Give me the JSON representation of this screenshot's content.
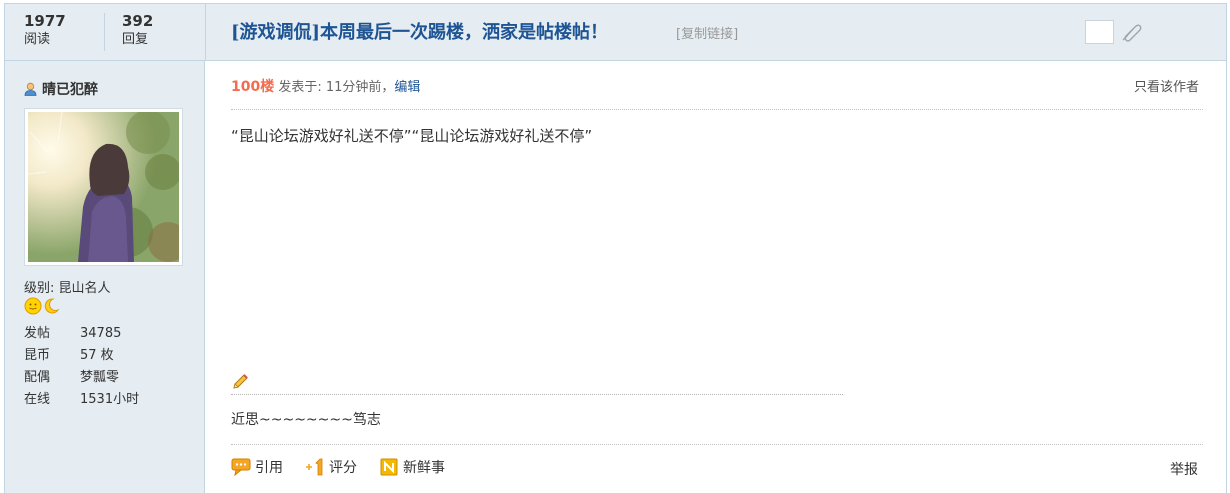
{
  "stats": {
    "views_value": "1977",
    "views_label": "阅读",
    "replies_value": "392",
    "replies_label": "回复"
  },
  "thread": {
    "title": "[游戏调侃]本周最后一次踢楼，洒家是帖楼帖！",
    "copy_link": "[复制链接]"
  },
  "author": {
    "name": "晴已犯醉",
    "level": "级别: 昆山名人",
    "info": [
      {
        "key": "发帖",
        "value": "34785"
      },
      {
        "key": "昆币",
        "value": "57 枚"
      },
      {
        "key": "配偶",
        "value": "梦瓢零"
      },
      {
        "key": "在线",
        "value": "1531小时"
      }
    ]
  },
  "post": {
    "floor": "100楼",
    "meta": " 发表于: 11分钟前，",
    "edit": "编辑",
    "only_author": "只看该作者",
    "content": "“昆山论坛游戏好礼送不停”“昆山论坛游戏好礼送不停”",
    "signature": "近思~~~~~~~~笃志"
  },
  "actions": {
    "quote": "引用",
    "rate": "评分",
    "fresh": "新鲜事",
    "report": "举报"
  },
  "colors": {
    "accent": "#1e5494",
    "floor": "#f26c4f",
    "panel_bg": "#e5edf2",
    "border": "#c2d5e3"
  }
}
